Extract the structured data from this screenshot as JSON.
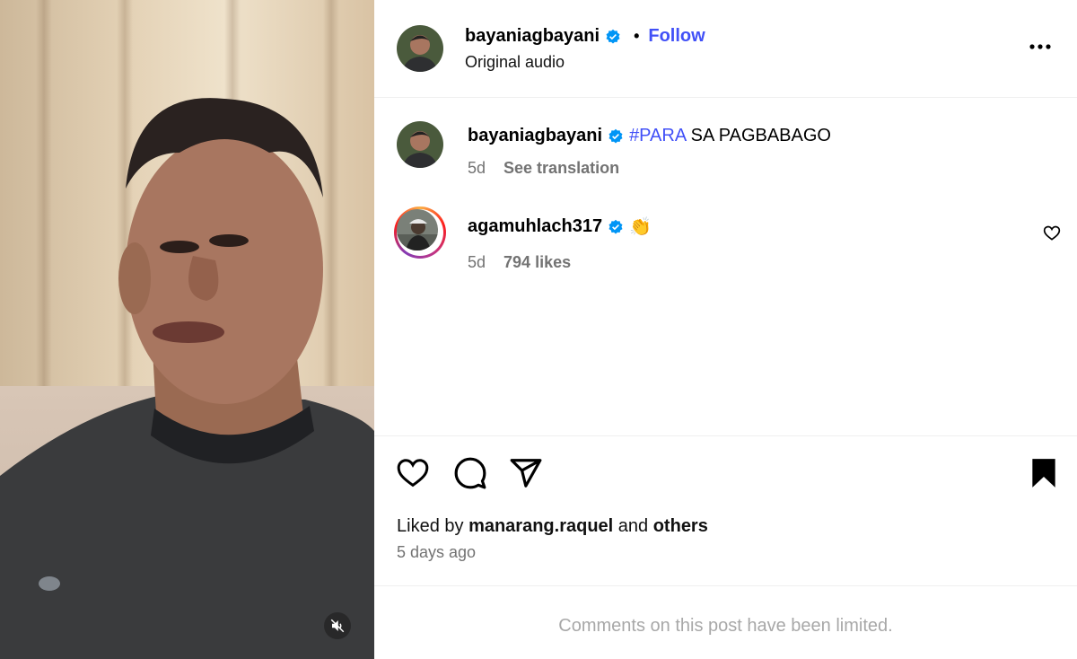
{
  "post": {
    "author": "bayaniagbayani",
    "follow_label": "Follow",
    "separator": "•",
    "audio": "Original audio"
  },
  "caption": {
    "username": "bayaniagbayani",
    "hashtag": "#PARA",
    "text": " SA PAGBABAGO",
    "age": "5d",
    "translate_label": "See translation"
  },
  "comment": {
    "username": "agamuhlach317",
    "emoji": "👏",
    "age": "5d",
    "likes": "794 likes"
  },
  "likes": {
    "prefix": "Liked by ",
    "user": "manarang.raquel",
    "middle": " and ",
    "others": "others"
  },
  "timestamp": "5 days ago",
  "comments_limited": "Comments on this post have been limited.",
  "colors": {
    "link": "#4150f7",
    "muted": "#737373",
    "verified": "#0095f6"
  },
  "icons": {
    "more": "more-options-icon",
    "like": "heart-icon",
    "comment": "comment-icon",
    "share": "send-icon",
    "save": "bookmark-icon",
    "mute": "speaker-muted-icon",
    "verified": "verified-badge-icon"
  }
}
